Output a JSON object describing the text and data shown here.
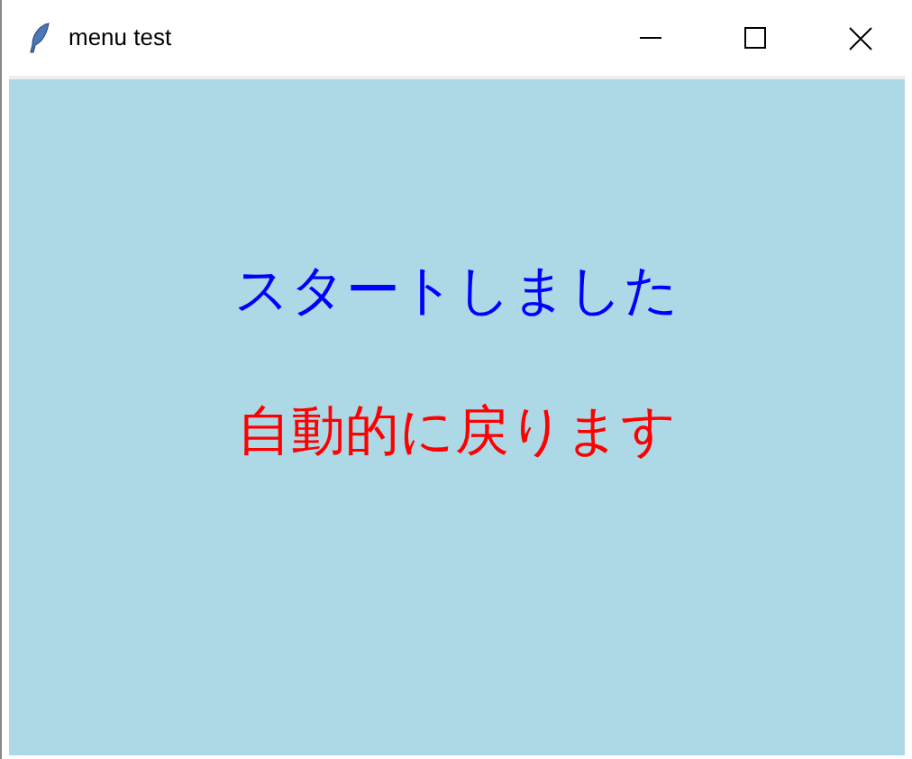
{
  "window": {
    "title": "menu test"
  },
  "messages": [
    {
      "text": "スタートしました",
      "color": "#0000ff"
    },
    {
      "text": "自動的に戻ります",
      "color": "#ff0000"
    }
  ]
}
